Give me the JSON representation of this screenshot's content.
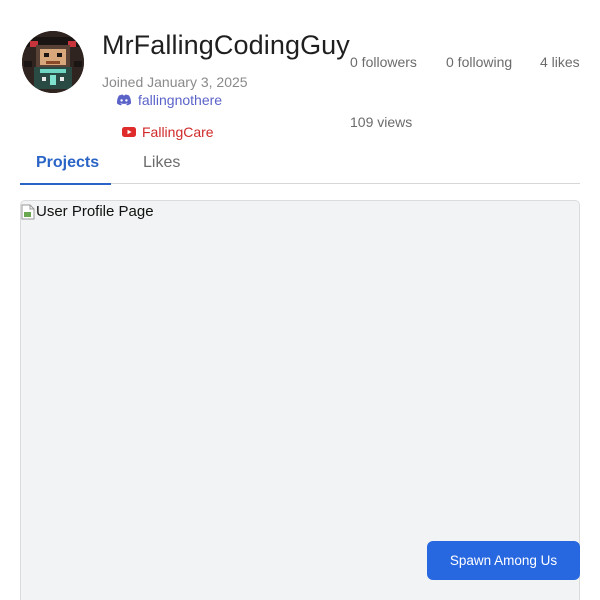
{
  "profile": {
    "username": "MrFallingCodingGuy",
    "joined": "Joined January 3, 2025",
    "avatar_icon": "user-avatar-pixel-character",
    "discord": {
      "icon": "discord-icon",
      "handle": "fallingnothere",
      "color": "#5b63c9"
    },
    "youtube": {
      "icon": "youtube-icon",
      "handle": "FallingCare",
      "color": "#d02a2a"
    }
  },
  "stats": {
    "followers": "0 followers",
    "following": "0 following",
    "likes": "4 likes",
    "views": "109 views"
  },
  "tabs": [
    {
      "label": "Projects",
      "active": true
    },
    {
      "label": "Likes",
      "active": false
    }
  ],
  "content": {
    "image_alt": "User Profile Page",
    "image_icon": "broken-image-icon"
  },
  "action_button": {
    "label": "Spawn Among Us",
    "color": "#2767e0"
  },
  "colors": {
    "accent": "#2a64c6",
    "divider": "#d6d6d6",
    "frame_bg": "#f2f3f4"
  }
}
